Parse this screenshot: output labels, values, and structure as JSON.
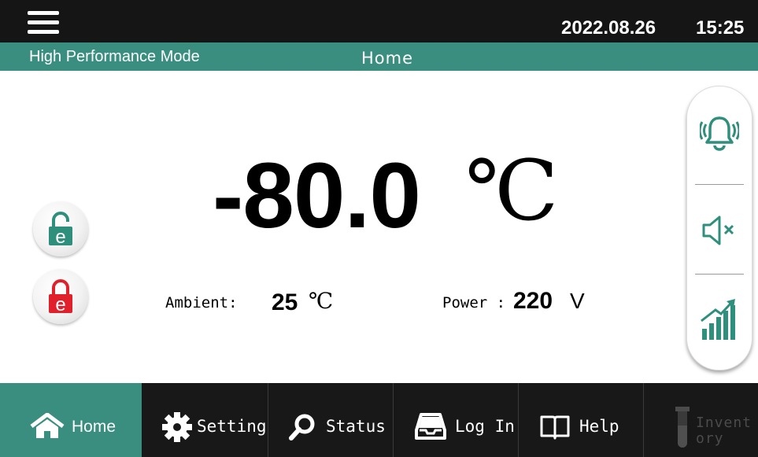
{
  "header": {
    "date": "2022.08.26",
    "time": "15:25",
    "mode": "High Performance Mode",
    "page_title": "Home"
  },
  "main": {
    "temperature": "-80.0",
    "temperature_unit": "℃",
    "ambient_label": "Ambient:",
    "ambient_value": "25",
    "ambient_unit": "℃",
    "power_label": "Power :",
    "power_value": "220",
    "power_unit": "V"
  },
  "locks": [
    {
      "name": "unlock",
      "letter": "e",
      "color": "#2f8f7d"
    },
    {
      "name": "lock",
      "letter": "e",
      "color": "#e0202b"
    }
  ],
  "side_panel": [
    {
      "name": "alarm-bell-icon"
    },
    {
      "name": "mute-icon"
    },
    {
      "name": "trend-chart-icon"
    }
  ],
  "nav": [
    {
      "label": "Home",
      "icon": "home-icon",
      "active": true
    },
    {
      "label": "Setting",
      "icon": "gear-icon"
    },
    {
      "label": "Status",
      "icon": "search-icon"
    },
    {
      "label": "Log In",
      "icon": "login-tray-icon"
    },
    {
      "label": "Help",
      "icon": "book-icon"
    },
    {
      "label_line1": "Invent",
      "label_line2": "ory",
      "icon": "test-tube-icon",
      "disabled": true
    }
  ],
  "colors": {
    "accent": "#3a8e7f",
    "dark": "#151515",
    "lock_red": "#e0202b",
    "lock_green": "#2f8f7d"
  }
}
